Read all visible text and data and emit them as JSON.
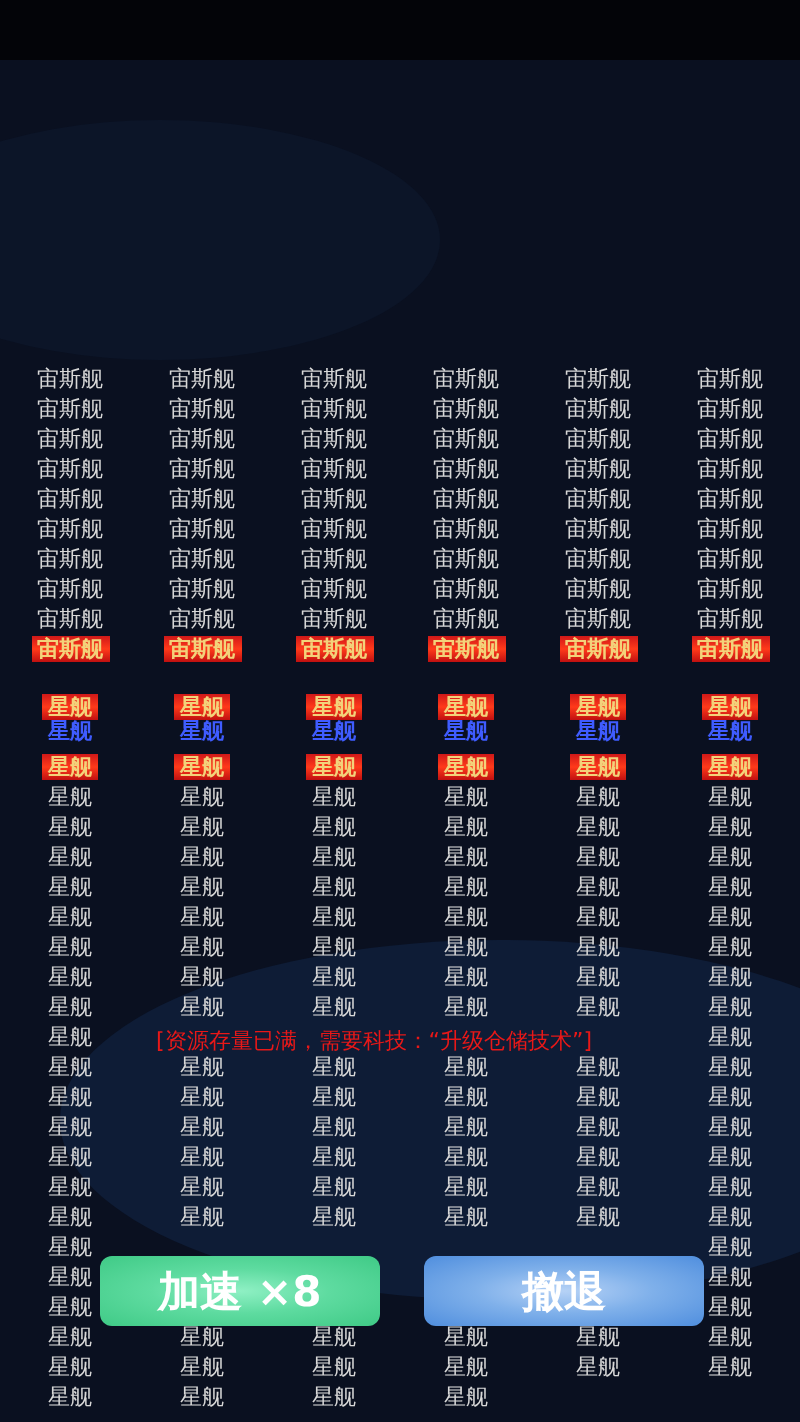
{
  "fleet_rows": [
    {
      "kind": "ship",
      "cells": [
        "宙斯舰",
        "宙斯舰",
        "宙斯舰",
        "宙斯舰",
        "宙斯舰",
        "宙斯舰"
      ]
    },
    {
      "kind": "ship",
      "cells": [
        "宙斯舰",
        "宙斯舰",
        "宙斯舰",
        "宙斯舰",
        "宙斯舰",
        "宙斯舰"
      ]
    },
    {
      "kind": "ship",
      "cells": [
        "宙斯舰",
        "宙斯舰",
        "宙斯舰",
        "宙斯舰",
        "宙斯舰",
        "宙斯舰"
      ]
    },
    {
      "kind": "ship",
      "cells": [
        "宙斯舰",
        "宙斯舰",
        "宙斯舰",
        "宙斯舰",
        "宙斯舰",
        "宙斯舰"
      ]
    },
    {
      "kind": "ship",
      "cells": [
        "宙斯舰",
        "宙斯舰",
        "宙斯舰",
        "宙斯舰",
        "宙斯舰",
        "宙斯舰"
      ]
    },
    {
      "kind": "ship",
      "cells": [
        "宙斯舰",
        "宙斯舰",
        "宙斯舰",
        "宙斯舰",
        "宙斯舰",
        "宙斯舰"
      ]
    },
    {
      "kind": "ship",
      "cells": [
        "宙斯舰",
        "宙斯舰",
        "宙斯舰",
        "宙斯舰",
        "宙斯舰",
        "宙斯舰"
      ]
    },
    {
      "kind": "ship",
      "cells": [
        "宙斯舰",
        "宙斯舰",
        "宙斯舰",
        "宙斯舰",
        "宙斯舰",
        "宙斯舰"
      ]
    },
    {
      "kind": "ship",
      "cells": [
        "宙斯舰",
        "宙斯舰",
        "宙斯舰",
        "宙斯舰",
        "宙斯舰",
        "宙斯舰"
      ]
    },
    {
      "kind": "burning",
      "cells": [
        "宙斯舰",
        "宙斯舰",
        "宙斯舰",
        "宙斯舰",
        "宙斯舰",
        "宙斯舰"
      ]
    },
    {
      "kind": "burning",
      "cells": [
        "星舰",
        "星舰",
        "星舰",
        "星舰",
        "星舰",
        "星舰"
      ]
    },
    {
      "kind": "shielded",
      "cells": [
        "星舰",
        "星舰",
        "星舰",
        "星舰",
        "星舰",
        "星舰"
      ]
    },
    {
      "kind": "burning",
      "cells": [
        "星舰",
        "星舰",
        "星舰",
        "星舰",
        "星舰",
        "星舰"
      ]
    },
    {
      "kind": "ship",
      "cells": [
        "星舰",
        "星舰",
        "星舰",
        "星舰",
        "星舰",
        "星舰"
      ]
    },
    {
      "kind": "ship",
      "cells": [
        "星舰",
        "星舰",
        "星舰",
        "星舰",
        "星舰",
        "星舰"
      ]
    },
    {
      "kind": "ship",
      "cells": [
        "星舰",
        "星舰",
        "星舰",
        "星舰",
        "星舰",
        "星舰"
      ]
    },
    {
      "kind": "ship",
      "cells": [
        "星舰",
        "星舰",
        "星舰",
        "星舰",
        "星舰",
        "星舰"
      ]
    },
    {
      "kind": "ship",
      "cells": [
        "星舰",
        "星舰",
        "星舰",
        "星舰",
        "星舰",
        "星舰"
      ]
    },
    {
      "kind": "ship",
      "cells": [
        "星舰",
        "星舰",
        "星舰",
        "星舰",
        "星舰",
        "星舰"
      ]
    },
    {
      "kind": "ship",
      "cells": [
        "星舰",
        "星舰",
        "星舰",
        "星舰",
        "星舰",
        "星舰"
      ]
    },
    {
      "kind": "ship",
      "cells": [
        "星舰",
        "星舰",
        "星舰",
        "星舰",
        "星舰",
        "星舰"
      ]
    },
    {
      "kind": "ship",
      "cells": [
        "星舰",
        "",
        "",
        "",
        "",
        "星舰"
      ]
    },
    {
      "kind": "ship",
      "cells": [
        "星舰",
        "星舰",
        "星舰",
        "星舰",
        "星舰",
        "星舰"
      ]
    },
    {
      "kind": "ship",
      "cells": [
        "星舰",
        "星舰",
        "星舰",
        "星舰",
        "星舰",
        "星舰"
      ]
    },
    {
      "kind": "ship",
      "cells": [
        "星舰",
        "星舰",
        "星舰",
        "星舰",
        "星舰",
        "星舰"
      ]
    },
    {
      "kind": "ship",
      "cells": [
        "星舰",
        "星舰",
        "星舰",
        "星舰",
        "星舰",
        "星舰"
      ]
    },
    {
      "kind": "ship",
      "cells": [
        "星舰",
        "星舰",
        "星舰",
        "星舰",
        "星舰",
        "星舰"
      ]
    },
    {
      "kind": "ship",
      "cells": [
        "星舰",
        "星舰",
        "星舰",
        "星舰",
        "星舰",
        "星舰"
      ]
    },
    {
      "kind": "ship",
      "cells": [
        "星舰",
        "",
        "",
        "",
        "",
        "星舰"
      ]
    },
    {
      "kind": "ship",
      "cells": [
        "星舰",
        "",
        "",
        "",
        "",
        "星舰"
      ]
    },
    {
      "kind": "ship",
      "cells": [
        "星舰",
        "",
        "",
        "",
        "",
        "星舰"
      ]
    },
    {
      "kind": "ship",
      "cells": [
        "星舰",
        "星舰",
        "星舰",
        "星舰",
        "星舰",
        "星舰"
      ]
    },
    {
      "kind": "ship",
      "cells": [
        "星舰",
        "星舰",
        "星舰",
        "星舰",
        "星舰",
        "星舰"
      ]
    },
    {
      "kind": "ship",
      "cells": [
        "星舰",
        "星舰",
        "星舰",
        "星舰"
      ]
    }
  ],
  "message": "[资源存量已满，需要科技：“升级仓储技术”]",
  "buttons": [
    {
      "kind": "boost",
      "label": "加速 ×8"
    },
    {
      "kind": "retreat",
      "label": "撤退"
    }
  ]
}
